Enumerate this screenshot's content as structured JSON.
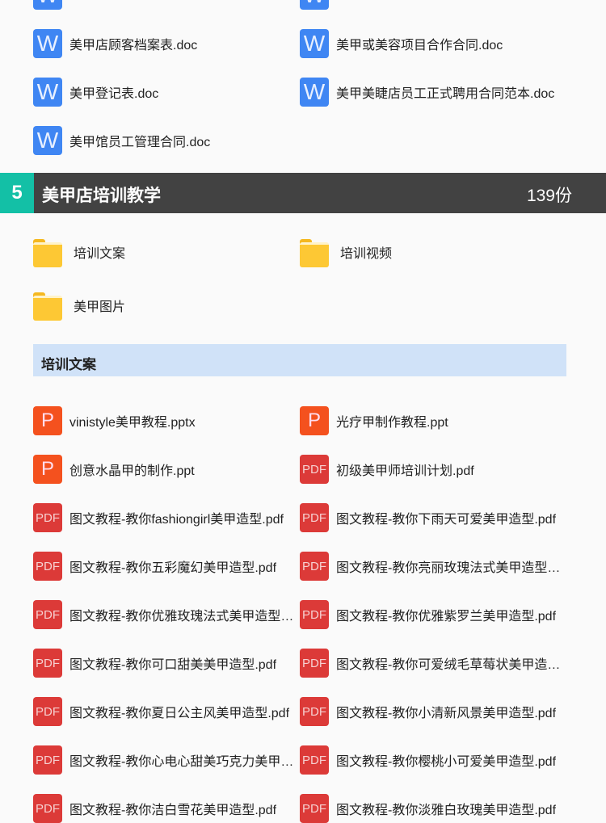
{
  "doc_files": [
    [
      "美甲店顾客档案表.doc",
      "美甲或美容项目合作合同.doc"
    ],
    [
      "美甲登记表.doc",
      "美甲美睫店员工正式聘用合同范本.doc"
    ],
    [
      "美甲馆员工管理合同.doc",
      null
    ]
  ],
  "section": {
    "number": "5",
    "title": "美甲店培训教学",
    "count": "139份"
  },
  "folders": [
    "培训文案",
    "培训视频",
    "美甲图片"
  ],
  "subheading": "培训文案",
  "files": [
    [
      {
        "type": "P",
        "name": "vinistyle美甲教程.pptx"
      },
      {
        "type": "P",
        "name": "光疗甲制作教程.ppt"
      }
    ],
    [
      {
        "type": "P",
        "name": "创意水晶甲的制作.ppt"
      },
      {
        "type": "PDF",
        "name": "初级美甲师培训计划.pdf"
      }
    ],
    [
      {
        "type": "PDF",
        "name": "图文教程-教你fashiongirl美甲造型.pdf"
      },
      {
        "type": "PDF",
        "name": "图文教程-教你下雨天可爱美甲造型.pdf"
      }
    ],
    [
      {
        "type": "PDF",
        "name": "图文教程-教你五彩魔幻美甲造型.pdf"
      },
      {
        "type": "PDF",
        "name": "图文教程-教你亮丽玫瑰法式美甲造型.pdf"
      }
    ],
    [
      {
        "type": "PDF",
        "name": "图文教程-教你优雅玫瑰法式美甲造型.pdf"
      },
      {
        "type": "PDF",
        "name": "图文教程-教你优雅紫罗兰美甲造型.pdf"
      }
    ],
    [
      {
        "type": "PDF",
        "name": "图文教程-教你可口甜美美甲造型.pdf"
      },
      {
        "type": "PDF",
        "name": "图文教程-教你可爱绒毛草莓状美甲造型.pdf"
      }
    ],
    [
      {
        "type": "PDF",
        "name": "图文教程-教你夏日公主风美甲造型.pdf"
      },
      {
        "type": "PDF",
        "name": "图文教程-教你小清新风景美甲造型.pdf"
      }
    ],
    [
      {
        "type": "PDF",
        "name": "图文教程-教你心电心甜美巧克力美甲造型.pdf"
      },
      {
        "type": "PDF",
        "name": "图文教程-教你樱桃小可爱美甲造型.pdf"
      }
    ],
    [
      {
        "type": "PDF",
        "name": "图文教程-教你洁白雪花美甲造型.pdf"
      },
      {
        "type": "PDF",
        "name": "图文教程-教你淡雅白玫瑰美甲造型.pdf"
      }
    ]
  ]
}
